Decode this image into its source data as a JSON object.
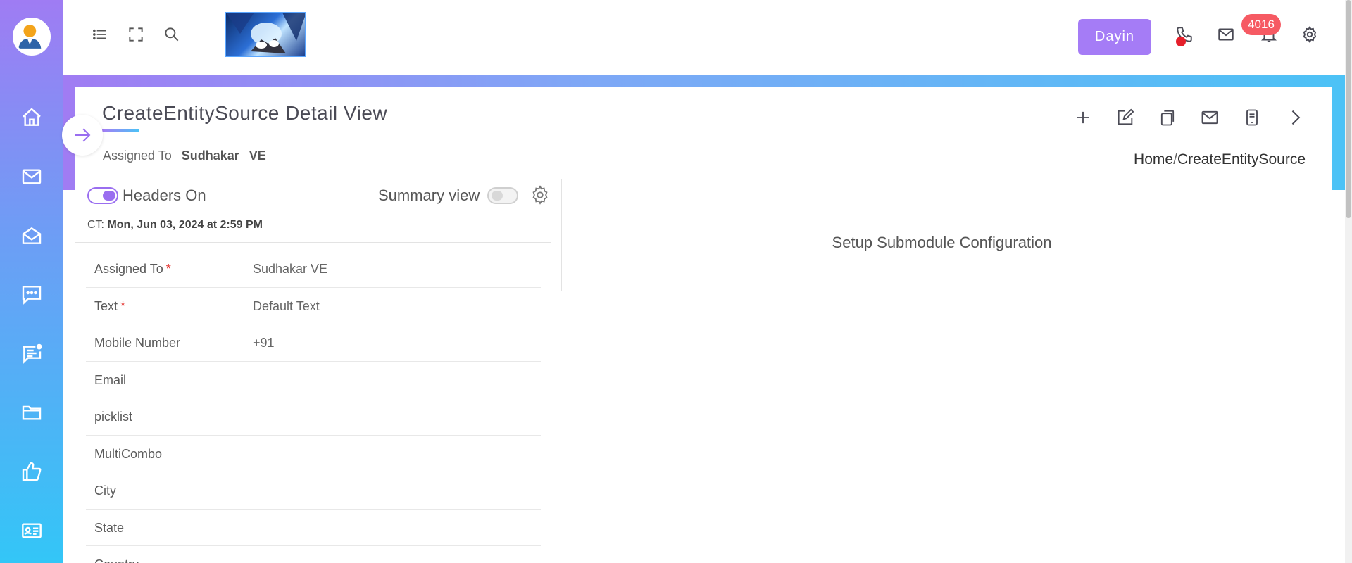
{
  "sidebar": {
    "items": [
      {
        "icon": "home-icon"
      },
      {
        "icon": "mail-icon"
      },
      {
        "icon": "mail-open-icon"
      },
      {
        "icon": "chat-icon"
      },
      {
        "icon": "message-notification-icon"
      },
      {
        "icon": "folder-icon"
      },
      {
        "icon": "thumbs-up-icon"
      },
      {
        "icon": "contact-card-icon"
      }
    ]
  },
  "topbar": {
    "user_button": "Dayin",
    "notification_count": "4016"
  },
  "page": {
    "title": "CreateEntitySource Detail View",
    "assigned_label": "Assigned To",
    "assigned_first": "Sudhakar",
    "assigned_last": "VE",
    "breadcrumb_home": "Home",
    "breadcrumb_sep": "/",
    "breadcrumb_current": "CreateEntitySource",
    "headers_label": "Headers On",
    "headers_on": true,
    "summary_label": "Summary view",
    "summary_on": false,
    "ct_prefix": "CT:",
    "ct_value": "Mon, Jun 03, 2024 at 2:59 PM",
    "submodule_text": "Setup Submodule Configuration"
  },
  "fields": [
    {
      "label": "Assigned To",
      "required": true,
      "value": "Sudhakar VE"
    },
    {
      "label": "Text",
      "required": true,
      "value": "Default Text"
    },
    {
      "label": "Mobile Number",
      "required": false,
      "value": "+91"
    },
    {
      "label": "Email",
      "required": false,
      "value": ""
    },
    {
      "label": "picklist",
      "required": false,
      "value": ""
    },
    {
      "label": "MultiCombo",
      "required": false,
      "value": ""
    },
    {
      "label": "City",
      "required": false,
      "value": ""
    },
    {
      "label": "State",
      "required": false,
      "value": ""
    },
    {
      "label": "Country",
      "required": false,
      "value": ""
    }
  ],
  "colors": {
    "accent": "#a57cf6",
    "sidebar_top": "#9f7cf3",
    "sidebar_bottom": "#33c6f7",
    "badge": "#f65a63",
    "required": "#e53935"
  }
}
